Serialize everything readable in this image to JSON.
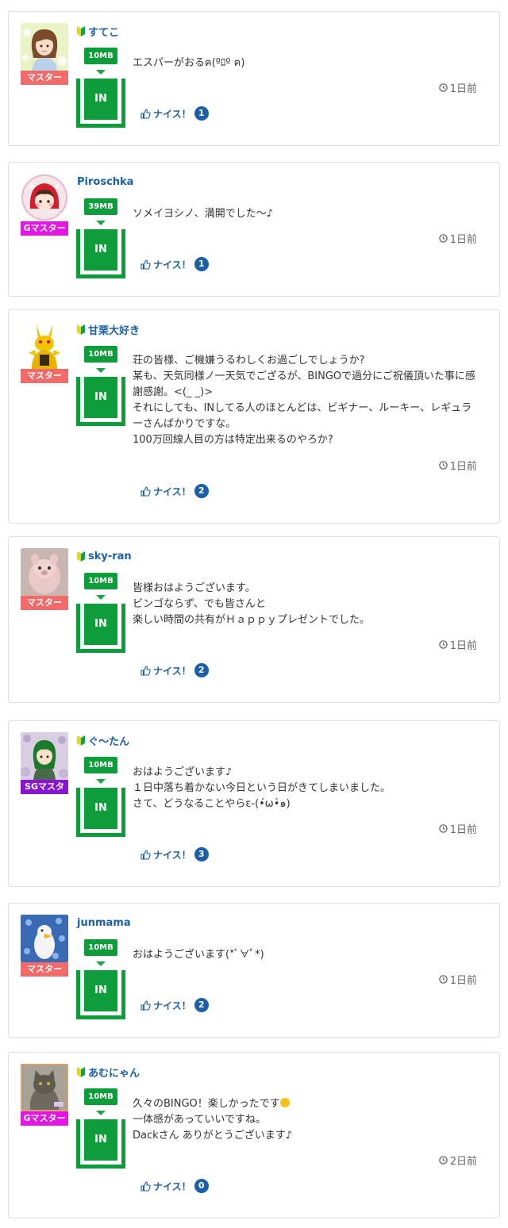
{
  "colors": {
    "green": "#0d9d3a",
    "link_blue": "#1b5fa8",
    "rank_master": "#f26a6a",
    "rank_gmaster": "#e614e6",
    "rank_sgmaster": "#8a14d6"
  },
  "icons": {
    "beginner": "beginner-mark-icon",
    "clock": "clock-icon",
    "thumb": "thumbs-up-icon"
  },
  "posts": [
    {
      "username": "すてこ",
      "beginner": true,
      "rank": "マスター",
      "rank_color": "#f26a6a",
      "mb": "10MB",
      "in_label": "IN",
      "lines": [
        "エスパーがおるฅ(ºﾛº ฅ)"
      ],
      "time": "1日前",
      "nice_label": "ナイス！",
      "nice_count": "1"
    },
    {
      "username": "Piroschka",
      "beginner": false,
      "rank": "Gマスター",
      "rank_color": "#e614e6",
      "mb": "39MB",
      "in_label": "IN",
      "lines": [
        "ソメイヨシノ、満開でした〜♪"
      ],
      "time": "1日前",
      "nice_label": "ナイス！",
      "nice_count": "1"
    },
    {
      "username": "甘栗大好き",
      "beginner": true,
      "rank": "マスター",
      "rank_color": "#f26a6a",
      "mb": "10MB",
      "in_label": "IN",
      "lines": [
        "荘の皆様、ご機嫌うるわしくお過ごしでしょうか?",
        "某も、天気同様ノ一天気でござるが、BINGOで過分にご祝儀頂いた事に感謝感謝。<(_ _)>",
        "それにしても、INしてる人のほとんどは、ビギナー、ルーキー、レギュラーさんばかりですな。",
        "100万回線人目の方は特定出来るのやろか?"
      ],
      "time": "1日前",
      "nice_label": "ナイス！",
      "nice_count": "2"
    },
    {
      "username": "sky-ran",
      "beginner": true,
      "rank": "マスター",
      "rank_color": "#f26a6a",
      "mb": "10MB",
      "in_label": "IN",
      "lines": [
        "皆様おはようございます。",
        "ビンゴならず、でも皆さんと",
        "楽しい時間の共有がＨａｐｐｙプレゼントでした。"
      ],
      "time": "1日前",
      "nice_label": "ナイス！",
      "nice_count": "2"
    },
    {
      "username": "ぐ〜たん",
      "beginner": true,
      "rank": "SGマスタ",
      "rank_color": "#8a14d6",
      "mb": "10MB",
      "in_label": "IN",
      "lines": [
        "おはようございます♪",
        "１日中落ち着かない今日という日がきてしまいました。",
        "さて、どうなることやらε-(•́ω•̀๑)"
      ],
      "time": "1日前",
      "nice_label": "ナイス！",
      "nice_count": "3"
    },
    {
      "username": "junmama",
      "beginner": false,
      "rank": "マスター",
      "rank_color": "#f26a6a",
      "mb": "10MB",
      "in_label": "IN",
      "lines": [
        "おはようございます(*ﾟ∀ﾟ*)"
      ],
      "time": "1日前",
      "nice_label": "ナイス！",
      "nice_count": "2"
    },
    {
      "username": "あむにゃん",
      "beginner": true,
      "rank": "Gマスター",
      "rank_color": "#e614e6",
      "mb": "10MB",
      "in_label": "IN",
      "lines": [
        "久々のBINGO！楽しかったです",
        "一体感があっていいですね。",
        "Dackさん ありがとうございます♪"
      ],
      "time": "2日前",
      "nice_label": "ナイス！",
      "nice_count": "0"
    }
  ]
}
